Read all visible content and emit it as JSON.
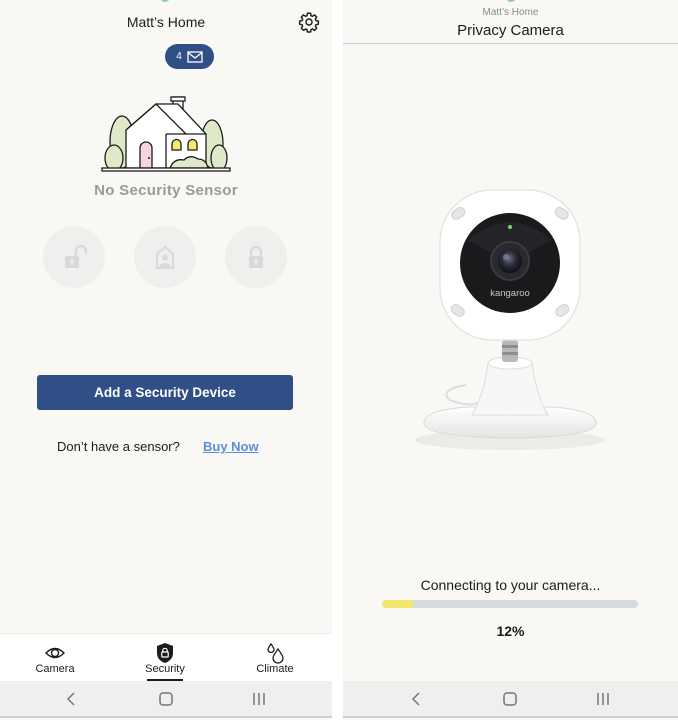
{
  "left_screen": {
    "header": {
      "home_name": "Matt’s Home",
      "settings_icon": "gear-icon",
      "message_count": "4",
      "message_icon": "envelope-icon"
    },
    "illustration": "house-illustration",
    "status_text": "No Security Sensor",
    "mode_buttons": [
      {
        "name": "disarm",
        "icon": "unlocked-padlock-icon"
      },
      {
        "name": "home",
        "icon": "house-person-icon"
      },
      {
        "name": "away",
        "icon": "locked-padlock-icon"
      }
    ],
    "add_button_label": "Add a Security Device",
    "no_sensor_question": "Don’t have a sensor?",
    "buy_now_link": "Buy Now",
    "bottom_nav": {
      "items": [
        {
          "label": "Camera",
          "icon": "eye-icon",
          "active": false
        },
        {
          "label": "Security",
          "icon": "shield-lock-icon",
          "active": true
        },
        {
          "label": "Climate",
          "icon": "water-drops-icon",
          "active": false
        }
      ]
    }
  },
  "right_screen": {
    "header": {
      "home_name": "Matt’s Home",
      "title": "Privacy Camera"
    },
    "camera_brand": "kangaroo",
    "connecting_text": "Connecting to your camera...",
    "progress": {
      "percent_value": 12,
      "percent_label": "12%"
    }
  },
  "system_nav": {
    "buttons": [
      "back",
      "home",
      "recents"
    ]
  },
  "colors": {
    "brand_blue": "#2f4f86",
    "link_blue": "#5a8fd8",
    "progress_yellow": "#f3e66b",
    "background": "#f9f8f5"
  }
}
